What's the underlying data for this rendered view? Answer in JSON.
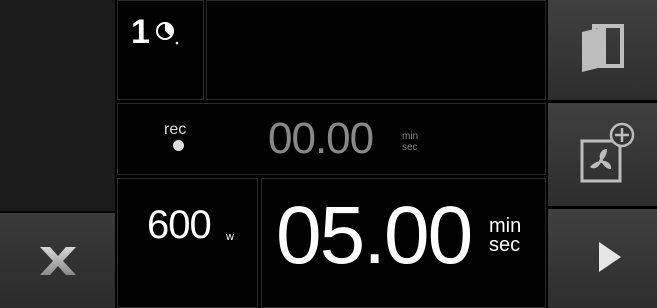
{
  "program": {
    "number": "1",
    "icon": "clock-icon"
  },
  "rec": {
    "label": "rec",
    "time": "00.00",
    "unit_top": "min",
    "unit_bottom": "sec"
  },
  "power": {
    "value": "600",
    "unit": "w"
  },
  "timer": {
    "time": "05.00",
    "unit_top": "min",
    "unit_bottom": "sec"
  },
  "buttons": {
    "cancel": {
      "icon": "close-icon"
    },
    "door": {
      "icon": "door-icon"
    },
    "fan": {
      "icon": "fan-plus-icon"
    },
    "start": {
      "icon": "play-icon"
    }
  },
  "colors": {
    "background": "#000000",
    "button": "#3a3a3a",
    "text": "#ffffff",
    "muted": "#888888"
  }
}
